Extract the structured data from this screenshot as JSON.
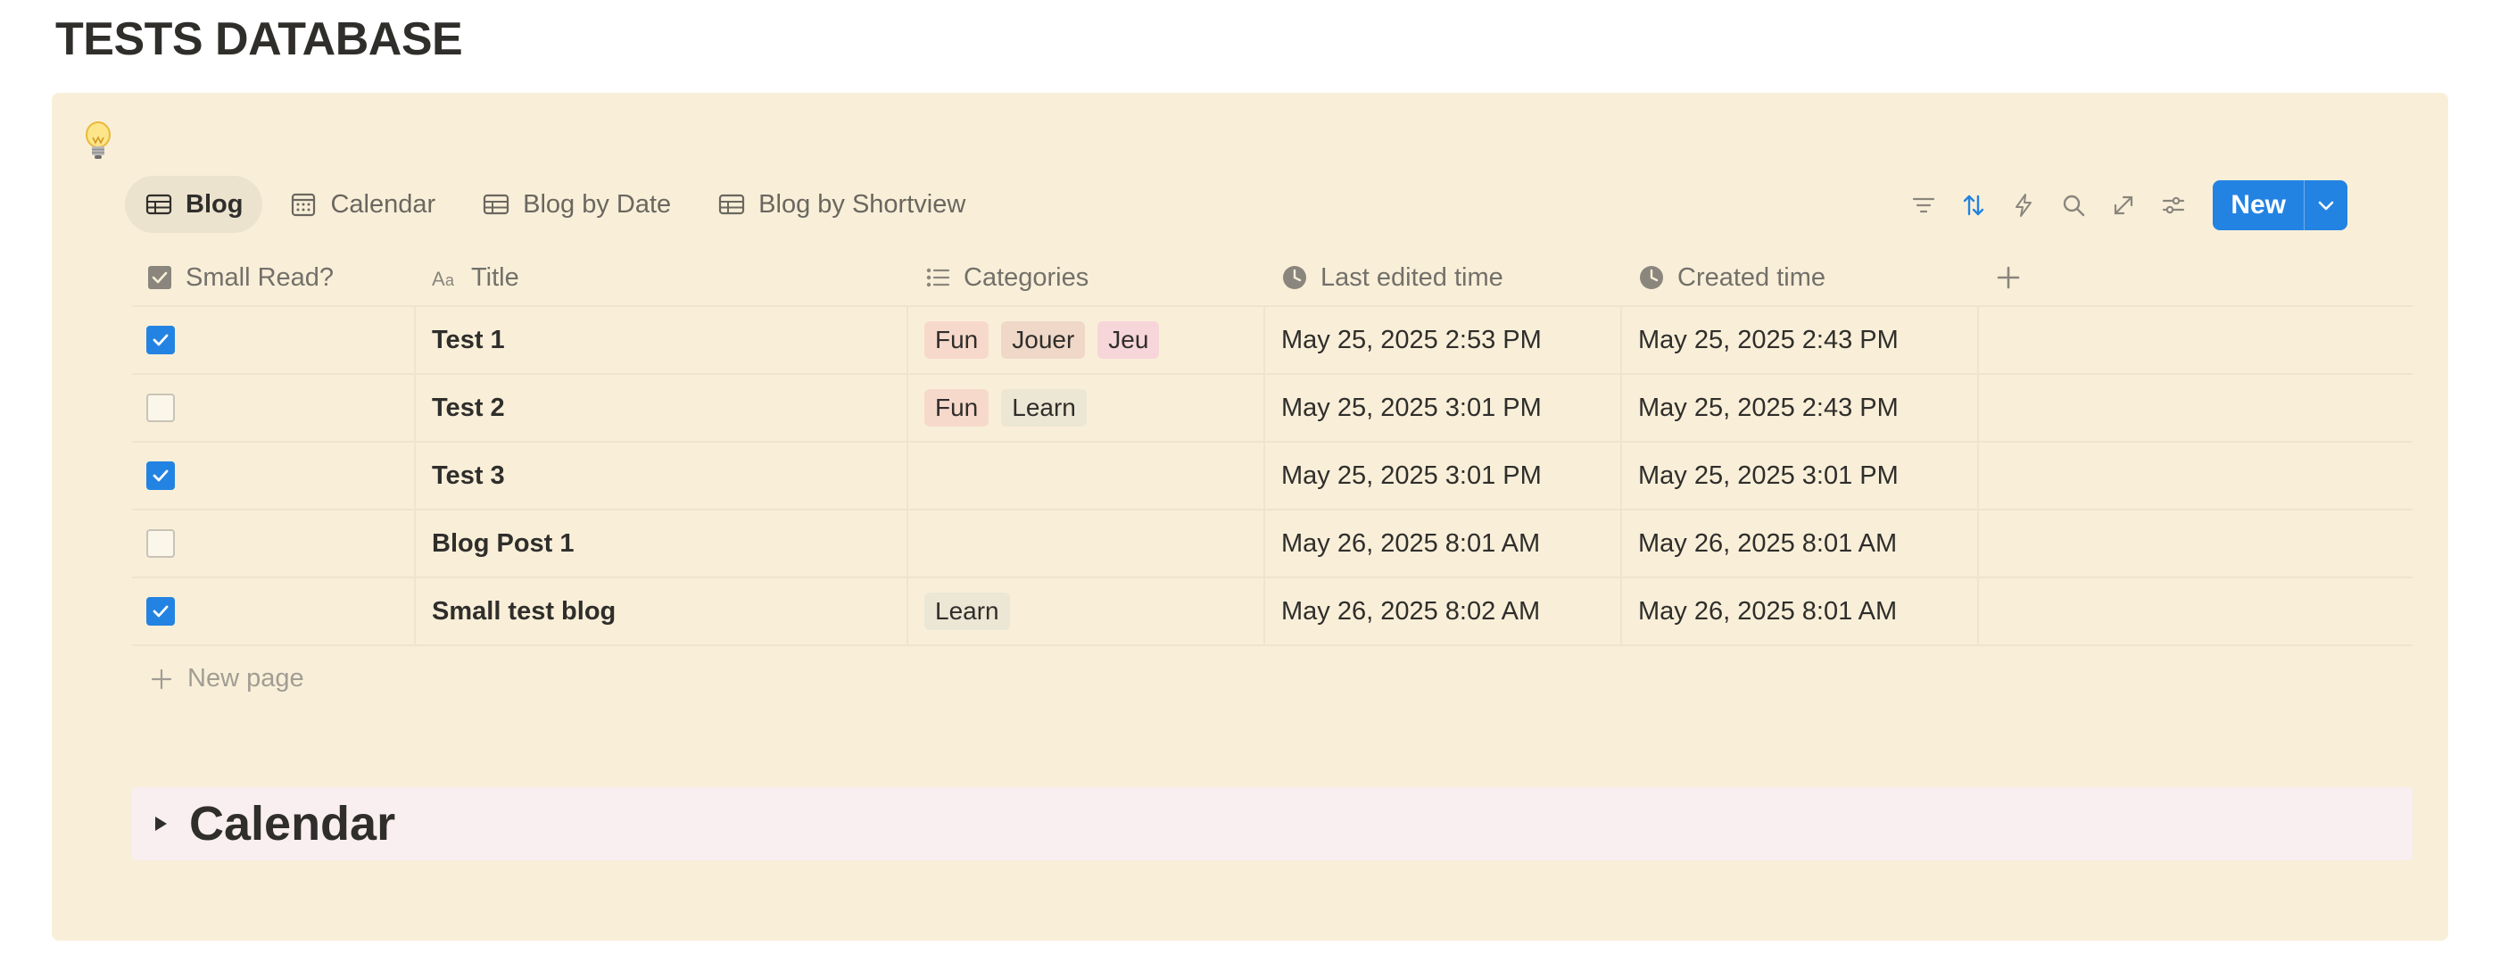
{
  "page": {
    "title": "TESTS DATABASE"
  },
  "callout": {
    "icon": "lightbulb-icon"
  },
  "views": [
    {
      "label": "Blog",
      "icon": "table-icon",
      "active": true
    },
    {
      "label": "Calendar",
      "icon": "calendar-icon",
      "active": false
    },
    {
      "label": "Blog by Date",
      "icon": "table-icon",
      "active": false
    },
    {
      "label": "Blog by Shortview",
      "icon": "table-icon",
      "active": false
    }
  ],
  "toolbar": {
    "icons": [
      "filter-icon",
      "sort-icon",
      "automation-icon",
      "search-icon",
      "expand-icon",
      "settings-icon"
    ],
    "new_label": "New",
    "accent": "#2383e2"
  },
  "table": {
    "columns": [
      {
        "label": "Small Read?",
        "icon": "checkbox-icon"
      },
      {
        "label": "Title",
        "icon": "text-icon"
      },
      {
        "label": "Categories",
        "icon": "list-icon"
      },
      {
        "label": "Last edited time",
        "icon": "clock-icon"
      },
      {
        "label": "Created time",
        "icon": "clock-icon"
      }
    ],
    "rows": [
      {
        "small_read": true,
        "title": "Test 1",
        "categories": [
          "Fun",
          "Jouer",
          "Jeu"
        ],
        "last_edited": "May 25, 2025 2:53 PM",
        "created": "May 25, 2025 2:43 PM"
      },
      {
        "small_read": false,
        "title": "Test 2",
        "categories": [
          "Fun",
          "Learn"
        ],
        "last_edited": "May 25, 2025 3:01 PM",
        "created": "May 25, 2025 2:43 PM"
      },
      {
        "small_read": true,
        "title": "Test 3",
        "categories": [],
        "last_edited": "May 25, 2025 3:01 PM",
        "created": "May 25, 2025 3:01 PM"
      },
      {
        "small_read": false,
        "title": "Blog Post 1",
        "categories": [],
        "last_edited": "May 26, 2025 8:01 AM",
        "created": "May 26, 2025 8:01 AM"
      },
      {
        "small_read": true,
        "title": "Small test blog",
        "categories": [
          "Learn"
        ],
        "last_edited": "May 26, 2025 8:02 AM",
        "created": "May 26, 2025 8:01 AM"
      }
    ],
    "tag_colors": {
      "Fun": "#f7d9cc",
      "Jouer": "#efd8c8",
      "Jeu": "#f6d6d9",
      "Learn": "#ece6d4"
    },
    "new_page_label": "New page"
  },
  "toggle": {
    "title": "Calendar"
  }
}
